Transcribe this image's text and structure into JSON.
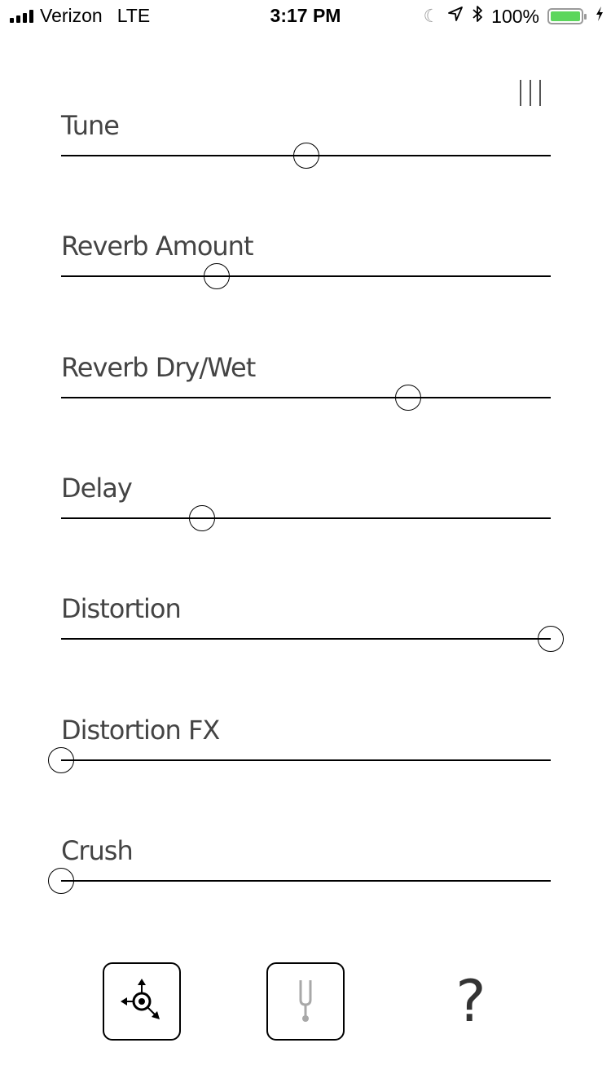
{
  "status_bar": {
    "carrier": "Verizon",
    "network": "LTE",
    "time": "3:17 PM",
    "battery_percent": "100%",
    "battery_level": 1.0,
    "battery_color": "#5cd65c",
    "icons": [
      "signal-icon",
      "moon-icon",
      "location-icon",
      "bluetooth-icon",
      "battery-icon",
      "charging-icon"
    ]
  },
  "menu": {
    "icon": "menu-icon"
  },
  "sliders": [
    {
      "id": "tune",
      "label": "Tune",
      "value": 0.5
    },
    {
      "id": "reverb-amount",
      "label": "Reverb Amount",
      "value": 0.318
    },
    {
      "id": "reverb-dry-wet",
      "label": "Reverb Dry/Wet",
      "value": 0.709
    },
    {
      "id": "delay",
      "label": "Delay",
      "value": 0.288
    },
    {
      "id": "distortion",
      "label": "Distortion",
      "value": 1.0
    },
    {
      "id": "distortion-fx",
      "label": "Distortion FX",
      "value": 0.0
    },
    {
      "id": "crush",
      "label": "Crush",
      "value": 0.0
    }
  ],
  "toolbar": {
    "buttons": [
      {
        "id": "xy-pad",
        "icon": "xy-pad-icon"
      },
      {
        "id": "tuner",
        "icon": "tuning-fork-icon"
      },
      {
        "id": "help",
        "label": "?",
        "icon": "help-icon"
      }
    ]
  }
}
